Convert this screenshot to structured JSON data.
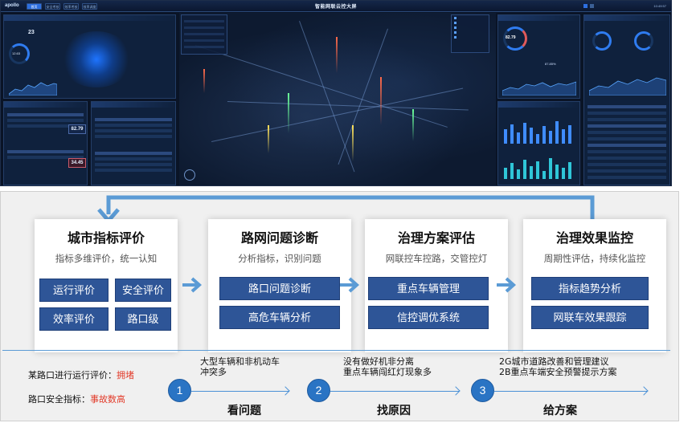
{
  "dashboard": {
    "logo": "apollo",
    "title": "智能网联云控大屏",
    "time": "10:49:57",
    "tabs": [
      "首页",
      "安全考核",
      "效率考核",
      "效率调度"
    ],
    "left_panel_value": "23",
    "left_panel_value2": "12.63",
    "box_values": [
      "82.79",
      "34.45"
    ],
    "right_donut_value": "82.79",
    "right_percent": "87.85%"
  },
  "flow": {
    "cards": [
      {
        "title": "城市指标评价",
        "subtitle": "指标多维评价，统一认知",
        "buttons": [
          "运行评价",
          "安全评价",
          "效率评价",
          "路口级"
        ]
      },
      {
        "title": "路网问题诊断",
        "subtitle": "分析指标，识别问题",
        "buttons": [
          "路口问题诊断",
          "高危车辆分析"
        ]
      },
      {
        "title": "治理方案评估",
        "subtitle": "网联控车控路，交管控灯",
        "buttons": [
          "重点车辆管理",
          "信控调优系统"
        ]
      },
      {
        "title": "治理效果监控",
        "subtitle": "周期性评估，持续化监控",
        "buttons": [
          "指标趋势分析",
          "网联车效果跟踪"
        ]
      }
    ],
    "issues": [
      {
        "prefix": "某路口进行运行评价：",
        "highlight": "拥堵"
      },
      {
        "prefix": "路口安全指标：",
        "highlight": "事故数高"
      }
    ],
    "steps": [
      {
        "number": "1",
        "label": "看问题",
        "desc_lines": [
          "大型车辆和非机动车",
          "冲突多"
        ]
      },
      {
        "number": "2",
        "label": "找原因",
        "desc_lines": [
          "没有做好机非分离",
          "重点车辆闯红灯现象多"
        ]
      },
      {
        "number": "3",
        "label": "给方案",
        "desc_lines": [
          "2G城市道路改善和管理建议",
          "2B重点车端安全预警提示方案"
        ]
      }
    ],
    "colors": {
      "button_bg": "#2e5597",
      "arrow": "#5b9bd5",
      "step_circle": "#2a74c4",
      "highlight_red": "#e23b2a"
    }
  }
}
